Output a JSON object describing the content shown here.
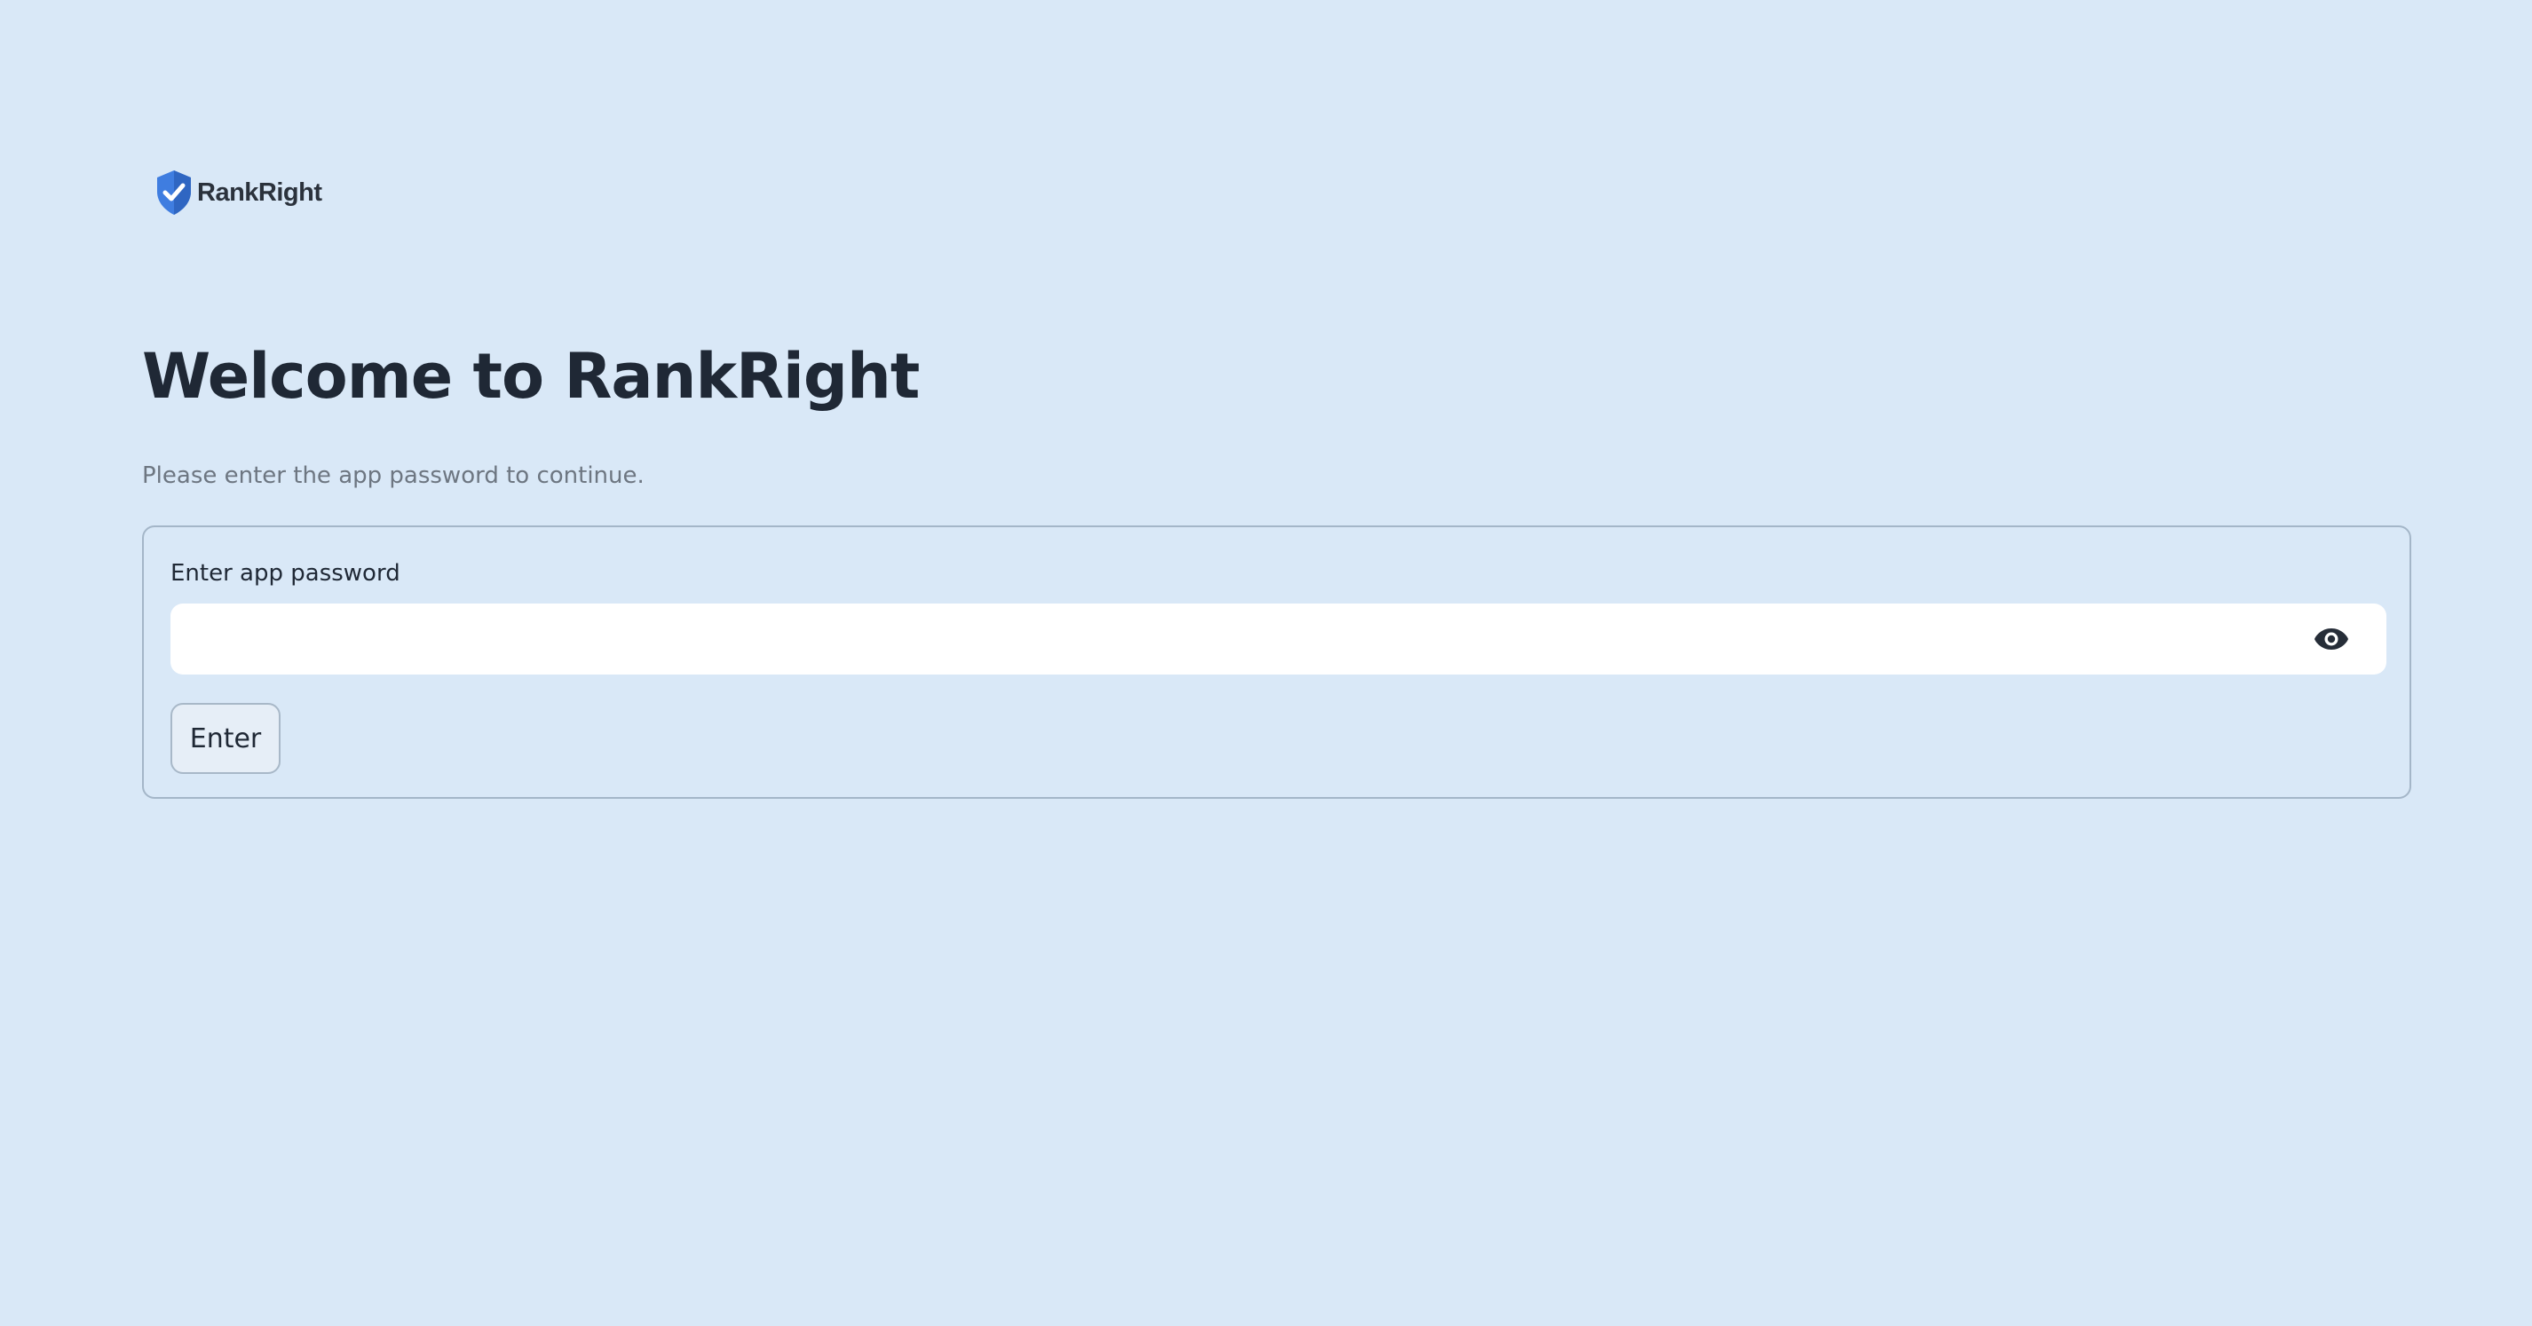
{
  "brand": {
    "name": "RankRight",
    "logo_icon": "shield-check-icon",
    "accent_color": "#3f7de0"
  },
  "header": {
    "title": "Welcome to RankRight",
    "subtitle": "Please enter the app password to continue."
  },
  "form": {
    "password_label": "Enter app password",
    "password_value": "",
    "visibility_icon": "eye-icon",
    "submit_label": "Enter"
  },
  "colors": {
    "background": "#d9e8f7",
    "title_text": "#1f2835",
    "muted_text": "#6d7681",
    "input_background": "#ffffff",
    "border": "#a4b6c8"
  }
}
